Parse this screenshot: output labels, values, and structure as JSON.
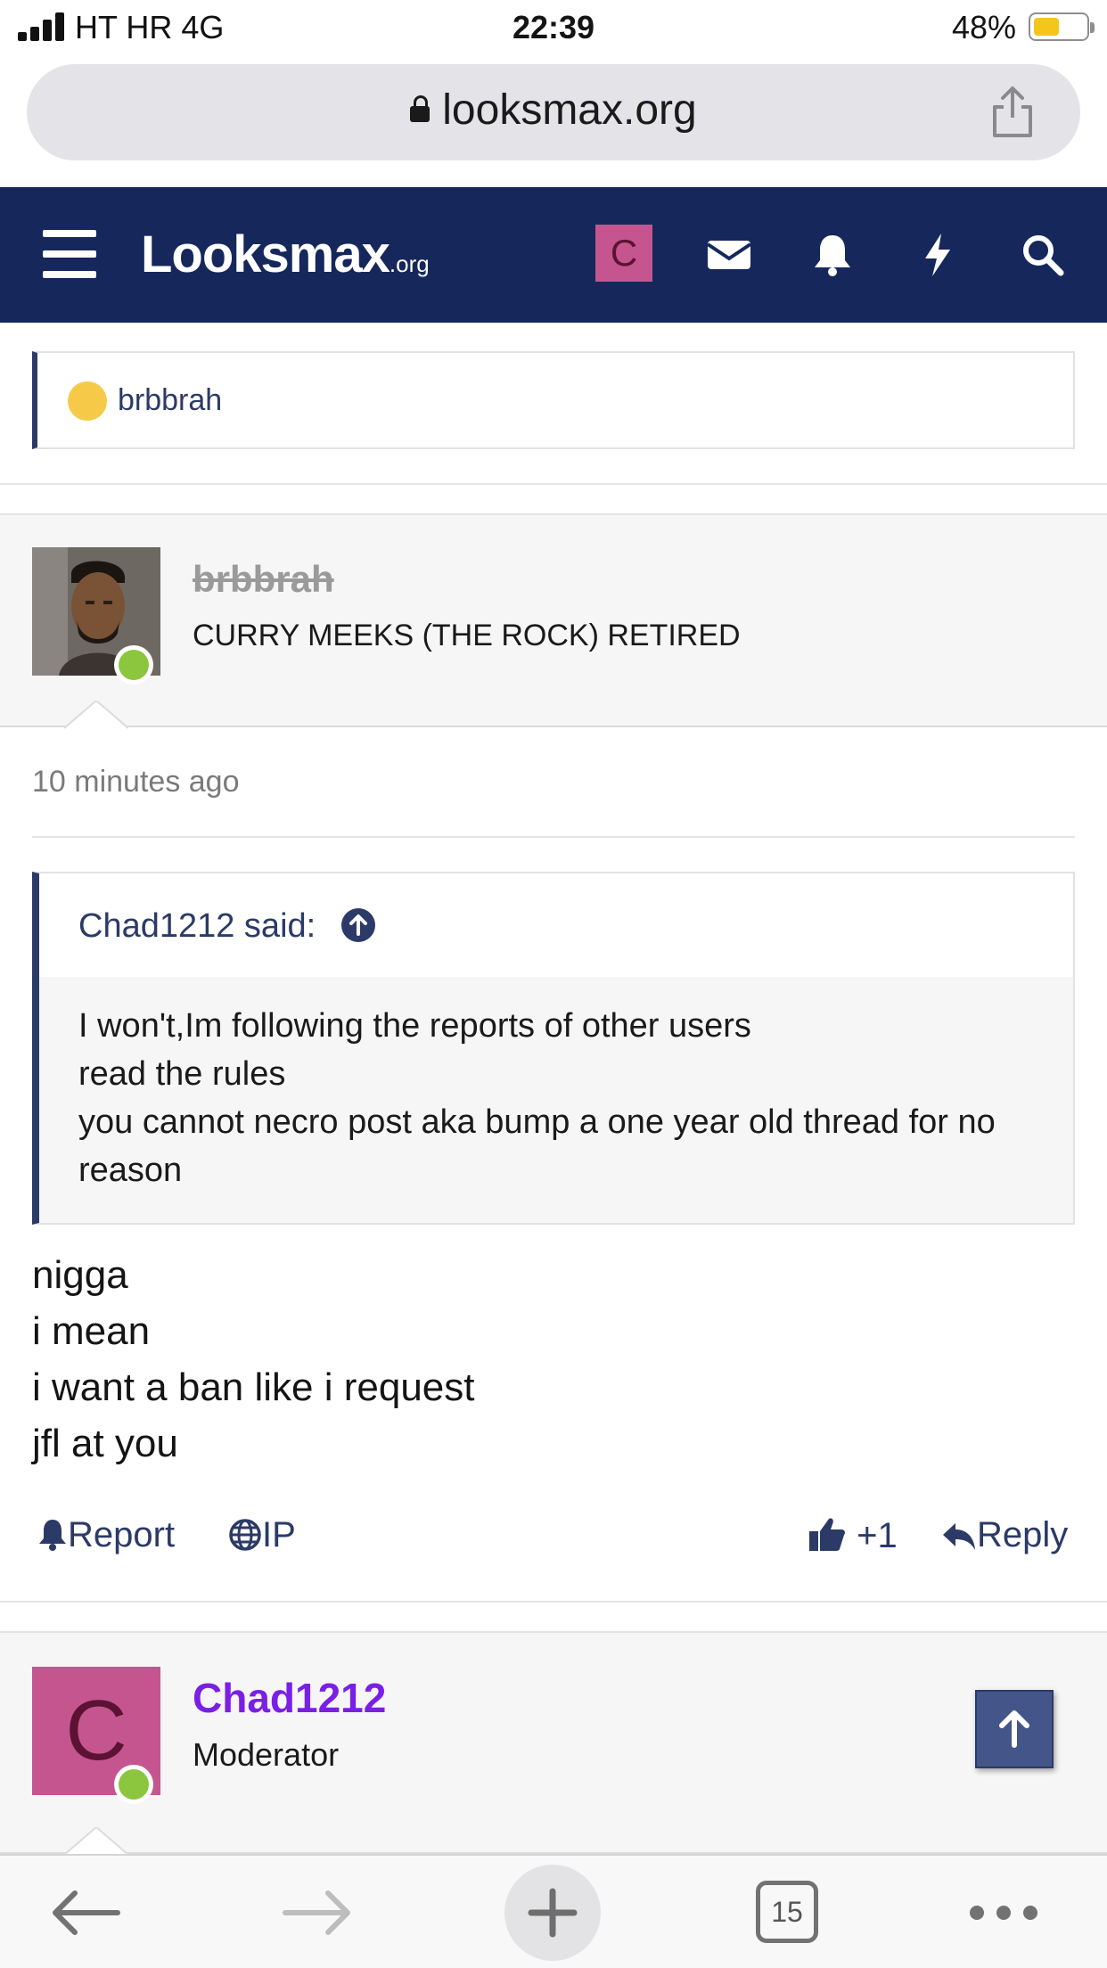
{
  "status_bar": {
    "carrier": "HT HR  4G",
    "time": "22:39",
    "battery": "48%"
  },
  "browser": {
    "url": "looksmax.org"
  },
  "site": {
    "logo_main": "Looksmax",
    "logo_suffix": ".org",
    "avatar_letter": "C"
  },
  "snippet": {
    "author": "brbbrah"
  },
  "post": {
    "username": "brbbrah",
    "user_title": "CURRY MEEKS (THE ROCK) RETIRED",
    "timestamp": "10 minutes ago",
    "quote": {
      "attribution": "Chad1212 said:",
      "lines": [
        "I won't,Im following the reports of other users",
        "read the rules",
        "you cannot necro post aka bump a one year old thread for no",
        "reason"
      ]
    },
    "message_lines": [
      "nigga",
      "i mean",
      "i want a ban like i request",
      "jfl at you"
    ],
    "actions": {
      "report": "Report",
      "ip": "IP",
      "like_count": "+1",
      "reply": "Reply"
    }
  },
  "next_post": {
    "avatar_letter": "C",
    "username": "Chad1212",
    "user_title": "Moderator"
  },
  "toolbar": {
    "tab_count": "15"
  }
}
